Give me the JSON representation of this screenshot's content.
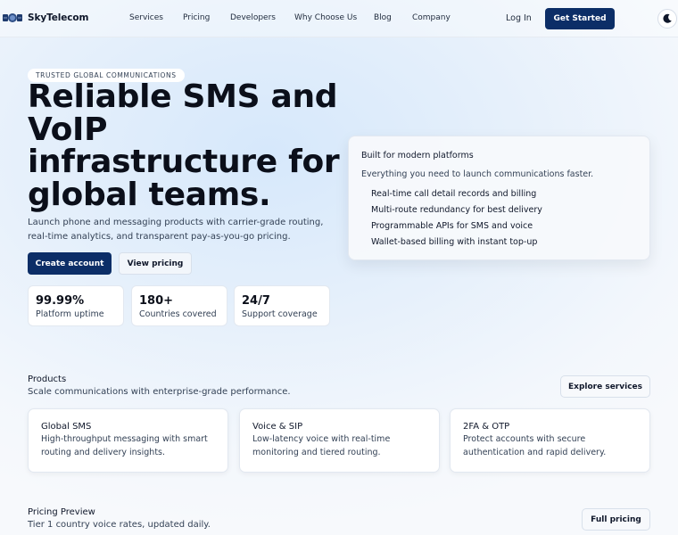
{
  "nav": {
    "brand": "SkyTelecom",
    "links": [
      "Services",
      "Pricing",
      "Developers",
      "Why Choose Us",
      "Blog",
      "Company"
    ],
    "login": "Log In",
    "cta": "Get Started"
  },
  "hero": {
    "badge": "TRUSTED GLOBAL COMMUNICATIONS",
    "title": "Reliable SMS and VoIP infrastructure for global teams.",
    "subtitle": "Launch phone and messaging products with carrier-grade routing, real-time analytics, and transparent pay-as-you-go pricing.",
    "primary_button": "Create account",
    "secondary_button": "View pricing",
    "stats": [
      {
        "value": "99.99%",
        "label": "Platform uptime"
      },
      {
        "value": "180+",
        "label": "Countries covered"
      },
      {
        "value": "24/7",
        "label": "Support coverage"
      }
    ]
  },
  "side_card": {
    "title": "Built for modern platforms",
    "subtitle": "Everything you need to launch communications faster.",
    "items": [
      "Real-time call detail records and billing",
      "Multi-route redundancy for best delivery",
      "Programmable APIs for SMS and voice",
      "Wallet-based billing with instant top-up"
    ]
  },
  "products": {
    "title": "Products",
    "subtitle": "Scale communications with enterprise-grade performance.",
    "button": "Explore services",
    "cards": [
      {
        "title": "Global SMS",
        "desc": "High-throughput messaging with smart routing and delivery insights."
      },
      {
        "title": "Voice & SIP",
        "desc": "Low-latency voice with real-time monitoring and tiered routing."
      },
      {
        "title": "2FA & OTP",
        "desc": "Protect accounts with secure authentication and rapid delivery."
      }
    ]
  },
  "pricing": {
    "title": "Pricing Preview",
    "subtitle": "Tier 1 country voice rates, updated daily.",
    "button": "Full pricing"
  },
  "colors": {
    "primary": "#0c2e67",
    "text": "#0f172a",
    "muted": "#334155"
  },
  "icons": {
    "logo": "satellite-logo-icon",
    "theme": "moon-icon"
  }
}
